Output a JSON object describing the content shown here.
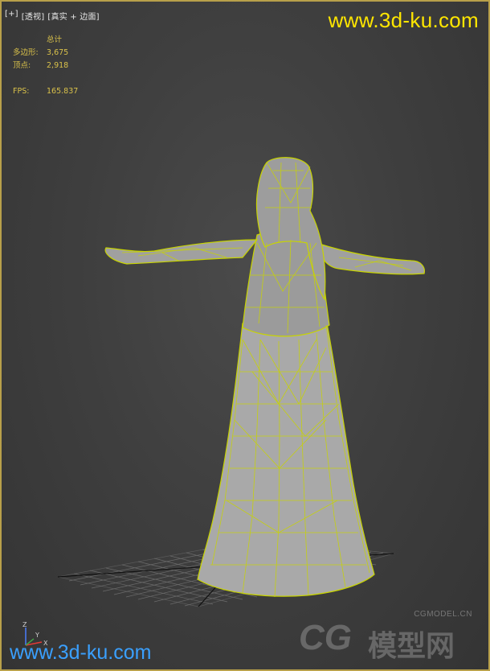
{
  "viewport": {
    "menu": [
      "[+]",
      "[透视]",
      "[真实 + 边面]"
    ]
  },
  "stats": {
    "header": "总计",
    "polygons_label": "多边形:",
    "polygons_value": "3,675",
    "vertices_label": "顶点:",
    "vertices_value": "2,918",
    "fps_label": "FPS:",
    "fps_value": "165.837"
  },
  "watermarks": {
    "top": "www.3d-ku.com",
    "bottom": "www.3d-ku.com",
    "logo_site": "CGMODEL.CN",
    "logo_big": "CG",
    "logo_cn": "模型网"
  },
  "gizmo": {
    "z": "Z",
    "x": "X",
    "y": "Y"
  },
  "colors": {
    "wire": "#c8d400",
    "stats_text": "#d9c14a",
    "frame": "#b8a04a",
    "watermark_top": "#ffe600",
    "watermark_bottom": "#3aa0ff"
  }
}
